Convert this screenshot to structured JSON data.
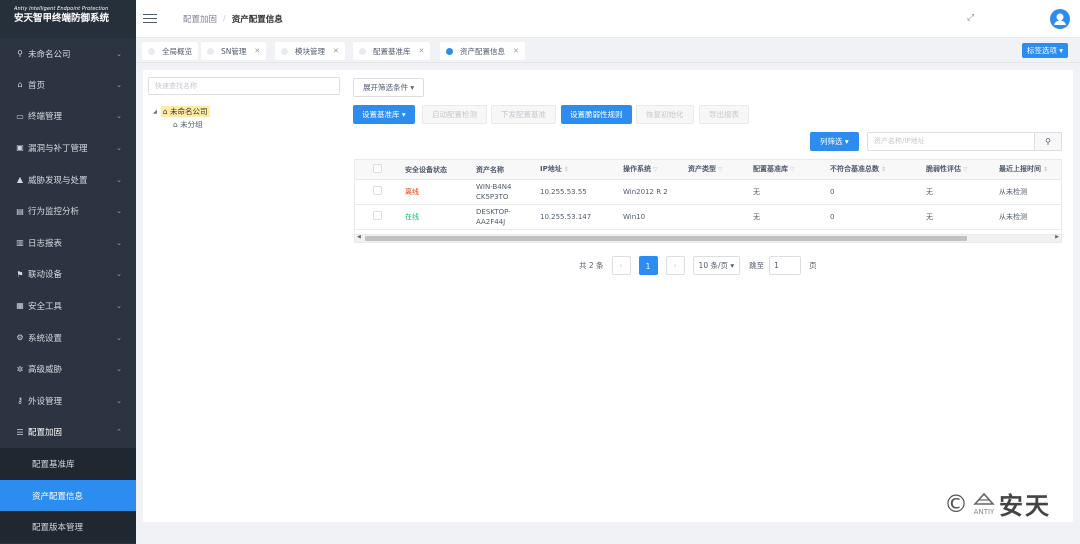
{
  "brand": {
    "en": "Antiy Intelligent Endpoint Protection",
    "cn": "安天智甲终端防御系统"
  },
  "sidebar": {
    "org": "未命名公司",
    "items": [
      {
        "icon": "⌂",
        "label": "首页"
      },
      {
        "icon": "▭",
        "label": "终端管理"
      },
      {
        "icon": "▣",
        "label": "漏洞与补丁管理"
      },
      {
        "icon": "▲",
        "label": "威胁发现与处置"
      },
      {
        "icon": "▤",
        "label": "行为监控分析"
      },
      {
        "icon": "▥",
        "label": "日志报表"
      },
      {
        "icon": "⚑",
        "label": "联动设备"
      },
      {
        "icon": "▦",
        "label": "安全工具"
      },
      {
        "icon": "⚙",
        "label": "系统设置"
      },
      {
        "icon": "✲",
        "label": "高级威胁"
      },
      {
        "icon": "⚷",
        "label": "外设管理"
      },
      {
        "icon": "☰",
        "label": "配置加固"
      }
    ],
    "sub": [
      "配置基准库",
      "资产配置信息",
      "配置版本管理"
    ]
  },
  "header": {
    "crumb1": "配置加固",
    "crumb2": "资产配置信息",
    "fullscreen": "⤢",
    "avatar": "●"
  },
  "tabs": [
    "全局概览",
    "SN管理",
    "模块管理",
    "配置基准库",
    "资产配置信息"
  ],
  "tab_options": "标签选项 ▾",
  "tree": {
    "search_placeholder": "快速查找名称",
    "root": "未命名公司",
    "child": "未分组"
  },
  "toolbar": {
    "expand_filter": "展开筛选条件 ▾",
    "set_baseline": "设置基准库 ▾",
    "start_check": "启动配置检测",
    "deliver_baseline": "下发配置基准",
    "set_vuln_rule": "设置脆弱性规则",
    "restore": "恢复初始化",
    "export": "导出报表",
    "col_filter": "列筛选 ▾",
    "search_placeholder": "资产名称/IP地址",
    "search_icon": "⚲"
  },
  "table": {
    "headers": [
      "安全设备状态",
      "资产名称",
      "IP地址",
      "操作系统",
      "资产类型",
      "配置基准库",
      "不符合基准总数",
      "脆弱性评估",
      "最近上报时间"
    ],
    "rows": [
      {
        "status": "离线",
        "name": "WIN-B4N4 CK5P3TO",
        "ip": "10.255.53.55",
        "os": "Win2012 R 2",
        "type": "",
        "baseline": "无",
        "noncompliant": "0",
        "vuln": "无",
        "last_report": "从未检测"
      },
      {
        "status": "在线",
        "name": "DESKTOP- AA2F44J",
        "ip": "10.255.53.147",
        "os": "Win10",
        "type": "",
        "baseline": "无",
        "noncompliant": "0",
        "vuln": "无",
        "last_report": "从未检测"
      }
    ]
  },
  "pager": {
    "total": "共 2 条",
    "prev": "‹",
    "current": "1",
    "next": "›",
    "size": "10 条/页 ▾",
    "goto": "跳至",
    "goto_value": "1",
    "page_unit": "页"
  },
  "watermark": {
    "symbol": "©",
    "logo_text": "ANTIY",
    "name": "安天"
  },
  "colors": {
    "primary": "#2d8cf0",
    "sidebar": "#2b3440",
    "online": "#19be6b",
    "offline": "#ed4014"
  }
}
